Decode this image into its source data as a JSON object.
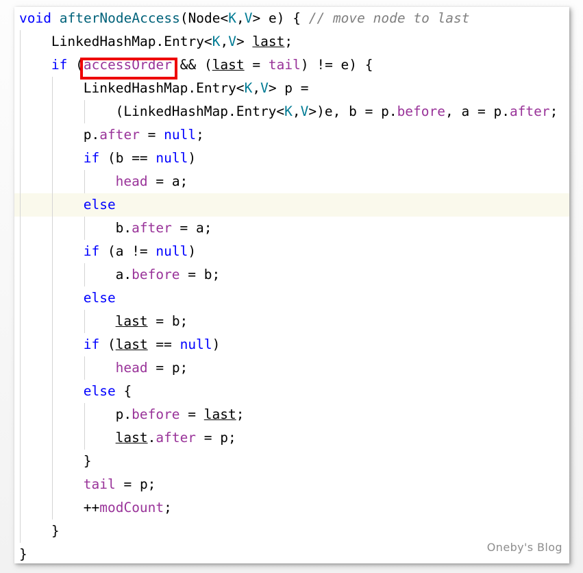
{
  "editor": {
    "language": "java",
    "caret_line_index": 8,
    "colors": {
      "background": "#ffffff",
      "caret_line_background": "#faf9ec",
      "keyword": "#0000ff",
      "method_declaration": "#00627a",
      "generic_type_param": "#007b94",
      "field": "#993399",
      "local_variable": "#000000",
      "comment": "#808080",
      "default_text": "#000000",
      "indent_guide": "#d4d4d4",
      "annotation_box": "#ee0000",
      "watermark": "#8d8d8d"
    },
    "lines": [
      {
        "indent": 0,
        "guides": 0,
        "tokens": [
          {
            "t": "void",
            "c": "kw"
          },
          {
            "t": " ",
            "c": "plain"
          },
          {
            "t": "afterNodeAccess",
            "c": "method"
          },
          {
            "t": "(Node<",
            "c": "plain"
          },
          {
            "t": "K",
            "c": "generic"
          },
          {
            "t": ",",
            "c": "plain"
          },
          {
            "t": "V",
            "c": "generic"
          },
          {
            "t": "> e) { ",
            "c": "plain"
          },
          {
            "t": "// move node to last",
            "c": "comment"
          }
        ]
      },
      {
        "indent": 1,
        "guides": 1,
        "tokens": [
          {
            "t": "LinkedHashMap.Entry<",
            "c": "plain"
          },
          {
            "t": "K",
            "c": "generic"
          },
          {
            "t": ",",
            "c": "plain"
          },
          {
            "t": "V",
            "c": "generic"
          },
          {
            "t": "> ",
            "c": "plain"
          },
          {
            "t": "last",
            "c": "local"
          },
          {
            "t": ";",
            "c": "plain"
          }
        ]
      },
      {
        "indent": 1,
        "guides": 1,
        "tokens": [
          {
            "t": "if",
            "c": "kw"
          },
          {
            "t": " (",
            "c": "plain"
          },
          {
            "t": "accessOrder",
            "c": "field"
          },
          {
            "t": " && (",
            "c": "plain"
          },
          {
            "t": "last",
            "c": "local"
          },
          {
            "t": " = ",
            "c": "plain"
          },
          {
            "t": "tail",
            "c": "field"
          },
          {
            "t": ") != e) {",
            "c": "plain"
          }
        ]
      },
      {
        "indent": 2,
        "guides": 2,
        "tokens": [
          {
            "t": "LinkedHashMap.Entry<",
            "c": "plain"
          },
          {
            "t": "K",
            "c": "generic"
          },
          {
            "t": ",",
            "c": "plain"
          },
          {
            "t": "V",
            "c": "generic"
          },
          {
            "t": "> p =",
            "c": "plain"
          }
        ]
      },
      {
        "indent": 3,
        "guides": 3,
        "tokens": [
          {
            "t": "(LinkedHashMap.Entry<",
            "c": "plain"
          },
          {
            "t": "K",
            "c": "generic"
          },
          {
            "t": ",",
            "c": "plain"
          },
          {
            "t": "V",
            "c": "generic"
          },
          {
            "t": ">)e, b = p.",
            "c": "plain"
          },
          {
            "t": "before",
            "c": "field"
          },
          {
            "t": ", a = p.",
            "c": "plain"
          },
          {
            "t": "after",
            "c": "field"
          },
          {
            "t": ";",
            "c": "plain"
          }
        ]
      },
      {
        "indent": 2,
        "guides": 2,
        "tokens": [
          {
            "t": "p.",
            "c": "plain"
          },
          {
            "t": "after",
            "c": "field"
          },
          {
            "t": " = ",
            "c": "plain"
          },
          {
            "t": "null",
            "c": "kw"
          },
          {
            "t": ";",
            "c": "plain"
          }
        ]
      },
      {
        "indent": 2,
        "guides": 2,
        "tokens": [
          {
            "t": "if",
            "c": "kw"
          },
          {
            "t": " (b == ",
            "c": "plain"
          },
          {
            "t": "null",
            "c": "kw"
          },
          {
            "t": ")",
            "c": "plain"
          }
        ]
      },
      {
        "indent": 3,
        "guides": 3,
        "tokens": [
          {
            "t": "head",
            "c": "field"
          },
          {
            "t": " = a;",
            "c": "plain"
          }
        ]
      },
      {
        "indent": 2,
        "guides": 2,
        "tokens": [
          {
            "t": "else",
            "c": "kw"
          }
        ]
      },
      {
        "indent": 3,
        "guides": 3,
        "tokens": [
          {
            "t": "b.",
            "c": "plain"
          },
          {
            "t": "after",
            "c": "field"
          },
          {
            "t": " = a;",
            "c": "plain"
          }
        ]
      },
      {
        "indent": 2,
        "guides": 2,
        "tokens": [
          {
            "t": "if",
            "c": "kw"
          },
          {
            "t": " (a != ",
            "c": "plain"
          },
          {
            "t": "null",
            "c": "kw"
          },
          {
            "t": ")",
            "c": "plain"
          }
        ]
      },
      {
        "indent": 3,
        "guides": 3,
        "tokens": [
          {
            "t": "a.",
            "c": "plain"
          },
          {
            "t": "before",
            "c": "field"
          },
          {
            "t": " = b;",
            "c": "plain"
          }
        ]
      },
      {
        "indent": 2,
        "guides": 2,
        "tokens": [
          {
            "t": "else",
            "c": "kw"
          }
        ]
      },
      {
        "indent": 3,
        "guides": 3,
        "tokens": [
          {
            "t": "last",
            "c": "local"
          },
          {
            "t": " = b;",
            "c": "plain"
          }
        ]
      },
      {
        "indent": 2,
        "guides": 2,
        "tokens": [
          {
            "t": "if",
            "c": "kw"
          },
          {
            "t": " (",
            "c": "plain"
          },
          {
            "t": "last",
            "c": "local"
          },
          {
            "t": " == ",
            "c": "plain"
          },
          {
            "t": "null",
            "c": "kw"
          },
          {
            "t": ")",
            "c": "plain"
          }
        ]
      },
      {
        "indent": 3,
        "guides": 3,
        "tokens": [
          {
            "t": "head",
            "c": "field"
          },
          {
            "t": " = p;",
            "c": "plain"
          }
        ]
      },
      {
        "indent": 2,
        "guides": 2,
        "tokens": [
          {
            "t": "else",
            "c": "kw"
          },
          {
            "t": " {",
            "c": "plain"
          }
        ]
      },
      {
        "indent": 3,
        "guides": 3,
        "tokens": [
          {
            "t": "p.",
            "c": "plain"
          },
          {
            "t": "before",
            "c": "field"
          },
          {
            "t": " = ",
            "c": "plain"
          },
          {
            "t": "last",
            "c": "local"
          },
          {
            "t": ";",
            "c": "plain"
          }
        ]
      },
      {
        "indent": 3,
        "guides": 3,
        "tokens": [
          {
            "t": "last",
            "c": "local"
          },
          {
            "t": ".",
            "c": "plain"
          },
          {
            "t": "after",
            "c": "field"
          },
          {
            "t": " = p;",
            "c": "plain"
          }
        ]
      },
      {
        "indent": 2,
        "guides": 2,
        "tokens": [
          {
            "t": "}",
            "c": "plain"
          }
        ]
      },
      {
        "indent": 2,
        "guides": 2,
        "tokens": [
          {
            "t": "tail",
            "c": "field"
          },
          {
            "t": " = p;",
            "c": "plain"
          }
        ]
      },
      {
        "indent": 2,
        "guides": 2,
        "tokens": [
          {
            "t": "++",
            "c": "plain"
          },
          {
            "t": "modCount",
            "c": "field"
          },
          {
            "t": ";",
            "c": "plain"
          }
        ]
      },
      {
        "indent": 1,
        "guides": 1,
        "tokens": [
          {
            "t": "}",
            "c": "plain"
          }
        ]
      },
      {
        "indent": 0,
        "guides": 0,
        "tokens": [
          {
            "t": "}",
            "c": "plain"
          }
        ]
      }
    ]
  },
  "annotation": {
    "highlight_target": "accessOrder",
    "box_color": "#ee0000"
  },
  "watermark": {
    "text": "Oneby's Blog"
  }
}
